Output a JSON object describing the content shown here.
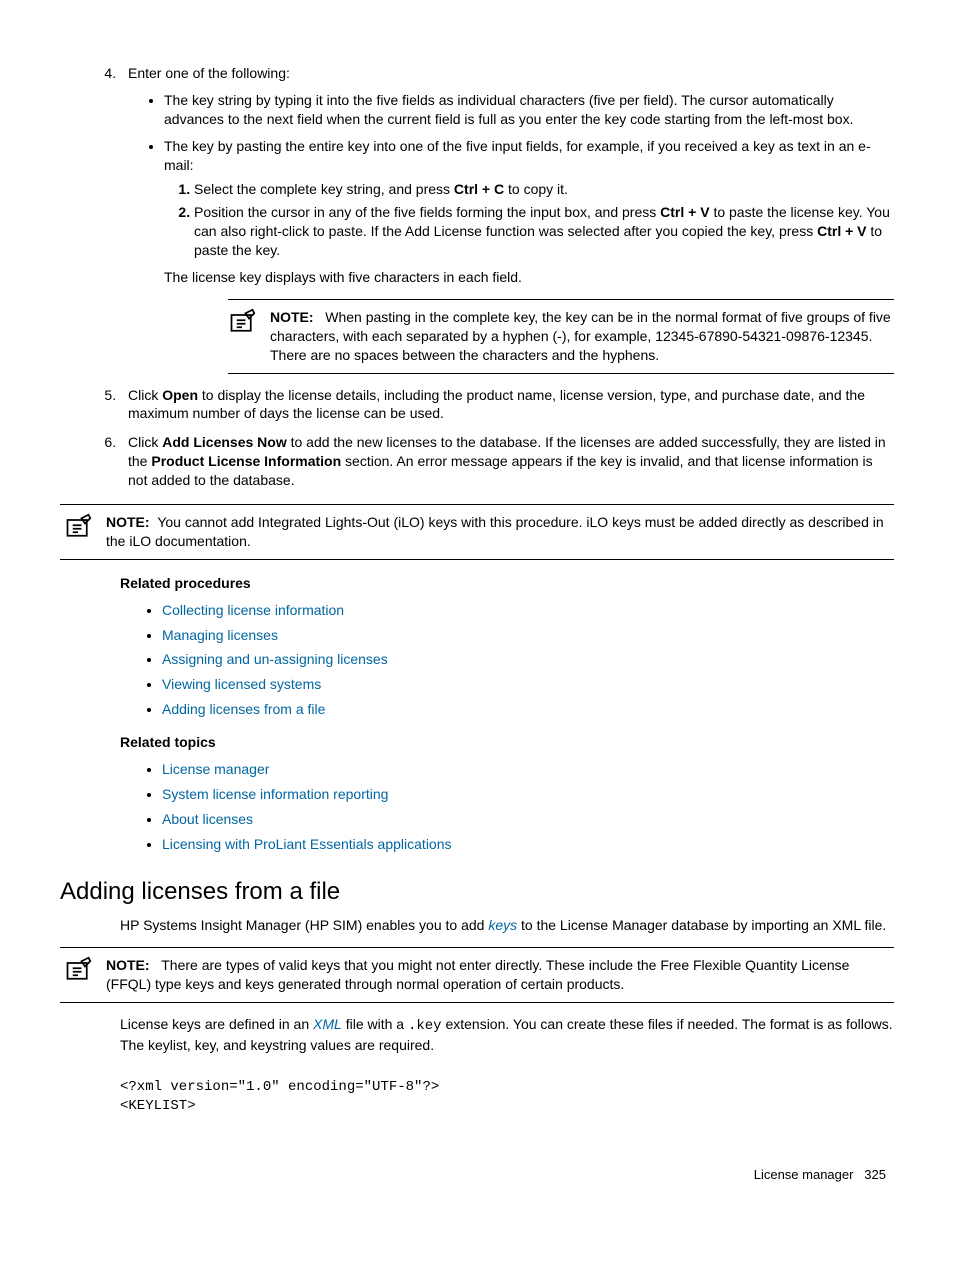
{
  "step4": {
    "numbered_start": "4",
    "intro": "Enter one of the following:",
    "bullet1": "The key string by typing it into the five fields as individual characters (five per field). The cursor automatically advances to the next field when the current field is full as you enter the key code starting from the left-most box.",
    "bullet2_intro": "The key by pasting the entire key into one of the five input fields, for example, if you received a key as text in an e-mail:",
    "sub1_pre": "Select the complete key string, and press ",
    "sub1_bold": "Ctrl + C",
    "sub1_post": " to copy it.",
    "sub2_pre": "Position the cursor in any of the five fields forming the input box, and press ",
    "sub2_bold1": "Ctrl + V",
    "sub2_mid": " to paste the license key. You can also right-click to paste. If the Add License function was selected after you copied the key, press ",
    "sub2_bold2": "Ctrl + V",
    "sub2_post": " to paste the key.",
    "post_sub": "The license key displays with five characters in each field."
  },
  "note1": {
    "label": "NOTE:",
    "text": "When pasting in the complete key, the key can be in the normal format of five groups of five characters, with each separated by a hyphen (-), for example, 12345-67890-54321-09876-12345. There are no spaces between the characters and the hyphens."
  },
  "step5": {
    "pre": "Click ",
    "bold": "Open",
    "post": " to display the license details, including the product name, license version, type, and purchase date, and the maximum number of days the license can be used."
  },
  "step6": {
    "pre": "Click ",
    "bold1": "Add Licenses Now",
    "mid": " to add the new licenses to the database. If the licenses are added successfully, they are listed in the ",
    "bold2": "Product License Information",
    "post": " section. An error message appears if the key is invalid, and that license information is not added to the database."
  },
  "note2": {
    "label": "NOTE:",
    "text": "You cannot add Integrated Lights-Out (iLO) keys with this procedure. iLO keys must be added directly as described in the iLO documentation."
  },
  "related_procedures": {
    "heading": "Related procedures",
    "items": [
      "Collecting license information",
      "Managing licenses",
      "Assigning and un-assigning licenses",
      "Viewing licensed systems",
      "Adding licenses from a file"
    ]
  },
  "related_topics": {
    "heading": "Related topics",
    "items": [
      "License manager",
      "System license information reporting",
      "About licenses",
      "Licensing with ProLiant Essentials applications"
    ]
  },
  "section_heading": "Adding licenses from a file",
  "intro_para": {
    "pre": "HP Systems Insight Manager (HP SIM) enables you to add ",
    "link": "keys",
    "post": " to the License Manager database by importing an XML file."
  },
  "note3": {
    "label": "NOTE:",
    "text": "There are types of valid keys that you might not enter directly. These include the Free Flexible Quantity License (FFQL) type keys and keys generated through normal operation of certain products."
  },
  "para2": {
    "pre": "License keys are defined in an ",
    "xml": "XML",
    "mid": " file with a ",
    "mono": ".key",
    "post": " extension. You can create these files if needed. The format is as follows. The keylist, key, and keystring values are required."
  },
  "xml_block": "<?xml version=\"1.0\" encoding=\"UTF-8\"?>\n<KEYLIST>",
  "footer": {
    "section": "License manager",
    "page": "325"
  }
}
